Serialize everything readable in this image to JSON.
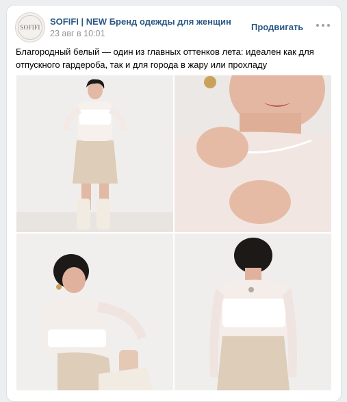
{
  "post": {
    "author": "SOFIFI | NEW Бренд одежды для женщин",
    "avatar_text": "SOFIFI",
    "date": "23 авг в 10:01",
    "promote_label": "Продвигать",
    "more_icon": "more-horizontal-icon",
    "text": "Благородный белый — один из главных оттенков лета: идеален как для отпускного гардероба, так и для города в жару или прохладу",
    "photos": [
      {
        "name": "photo-full-body-standing"
      },
      {
        "name": "photo-closeup-neckline"
      },
      {
        "name": "photo-seated-pose"
      },
      {
        "name": "photo-back-view"
      }
    ]
  },
  "colors": {
    "link": "#2a5885",
    "date": "#939393",
    "page_bg": "#edeef0",
    "card_bg": "#ffffff",
    "icon_gray": "#99a2ad"
  }
}
